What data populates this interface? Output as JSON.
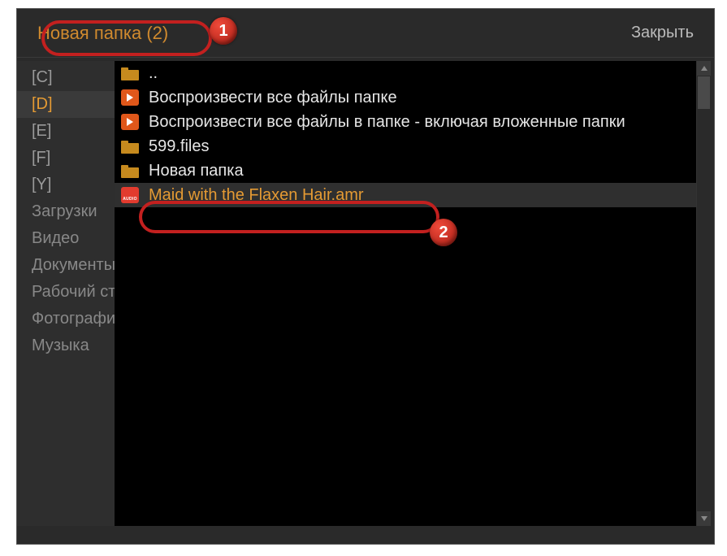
{
  "header": {
    "title": "Новая папка (2)",
    "close": "Закрыть"
  },
  "sidebar": {
    "drives": [
      {
        "label": "[C]",
        "selected": false
      },
      {
        "label": "[D]",
        "selected": true
      },
      {
        "label": "[E]",
        "selected": false
      },
      {
        "label": "[F]",
        "selected": false
      },
      {
        "label": "[Y]",
        "selected": false
      }
    ],
    "places": [
      {
        "label": "Загрузки"
      },
      {
        "label": "Видео"
      },
      {
        "label": "Документы"
      },
      {
        "label": "Рабочий стол"
      },
      {
        "label": "Фотографии"
      },
      {
        "label": "Музыка"
      }
    ]
  },
  "files": [
    {
      "icon": "folder",
      "label": "..",
      "selected": false
    },
    {
      "icon": "play",
      "label": "Воспроизвести все файлы папке",
      "selected": false
    },
    {
      "icon": "play",
      "label": "Воспроизвести все файлы в папке - включая вложенные папки",
      "selected": false
    },
    {
      "icon": "folder",
      "label": "599.files",
      "selected": false
    },
    {
      "icon": "folder",
      "label": "Новая папка",
      "selected": false
    },
    {
      "icon": "audio",
      "label": "Maid with the Flaxen Hair.amr",
      "selected": true
    }
  ],
  "callouts": {
    "badge1": "1",
    "badge2": "2"
  }
}
